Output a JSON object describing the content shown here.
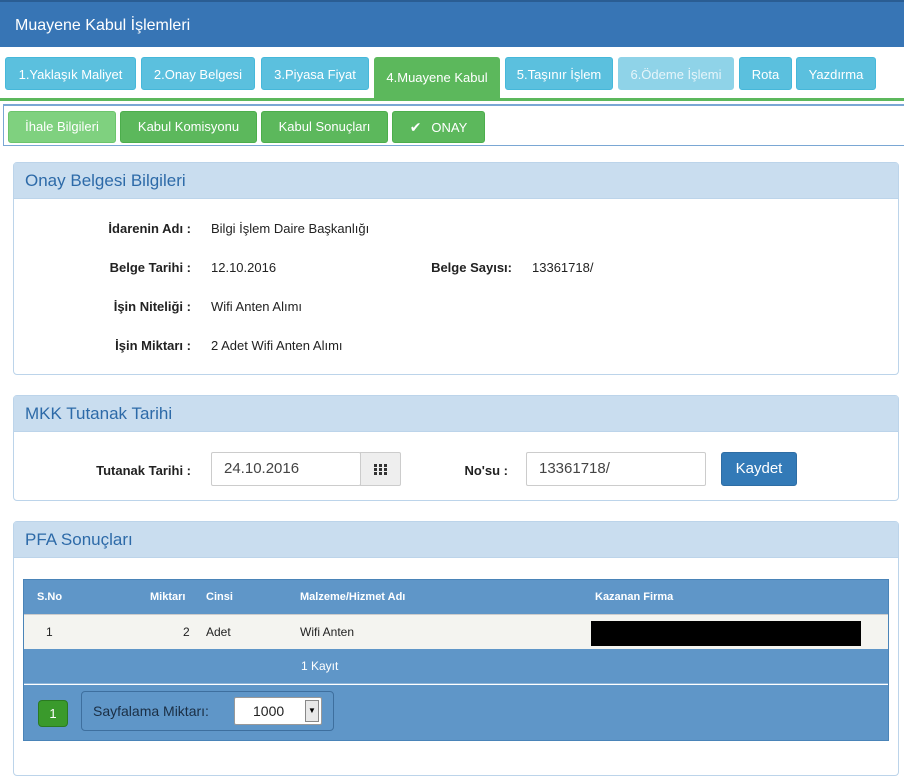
{
  "header": {
    "title": "Muayene Kabul İşlemleri"
  },
  "main_tabs": [
    {
      "label": "1.Yaklaşık Maliyet"
    },
    {
      "label": "2.Onay Belgesi"
    },
    {
      "label": "3.Piyasa Fiyat"
    },
    {
      "label": "4.Muayene Kabul"
    },
    {
      "label": "5.Taşınır İşlem"
    },
    {
      "label": "6.Ödeme İşlemi"
    },
    {
      "label": "Rota"
    },
    {
      "label": "Yazdırma"
    }
  ],
  "sub_tabs": [
    {
      "label": "İhale Bilgileri"
    },
    {
      "label": "Kabul Komisyonu"
    },
    {
      "label": "Kabul Sonuçları"
    },
    {
      "label": "ONAY",
      "icon": "check-icon"
    }
  ],
  "onay_panel": {
    "title": "Onay Belgesi Bilgileri",
    "idare_label": "İdarenin Adı :",
    "idare_value": "Bilgi İşlem Daire Başkanlığı",
    "tarih_label": "Belge Tarihi :",
    "tarih_value": "12.10.2016",
    "sayi_label": "Belge Sayısı:",
    "sayi_value": "13361718/",
    "nitelik_label": "İşin Niteliği :",
    "nitelik_value": "Wifi Anten Alımı",
    "miktar_label": "İşin Miktarı :",
    "miktar_value": "2 Adet Wifi Anten Alımı"
  },
  "mkk_panel": {
    "title": "MKK Tutanak Tarihi",
    "tarih_label": "Tutanak Tarihi :",
    "tarih_value": "24.10.2016",
    "no_label": "No'su :",
    "no_value": "13361718/",
    "save_label": "Kaydet",
    "calendar_icon": "calendar-icon"
  },
  "pfa_panel": {
    "title": "PFA Sonuçları",
    "columns": [
      "S.No",
      "Miktarı",
      "Cinsi",
      "Malzeme/Hizmet Adı",
      "Kazanan Firma"
    ],
    "rows": [
      {
        "sno": "1",
        "miktar": "2",
        "cinsi": "Adet",
        "malzeme": "Wifi Anten",
        "firma": ""
      }
    ],
    "record_count": "1 Kayıt",
    "current_page": "1",
    "page_size_label": "Sayfalama Miktarı:",
    "page_size_value": "1000"
  },
  "colors": {
    "header": "#3775b5",
    "tab": "#5bc0de",
    "active_tab": "#5cb85c",
    "panel_head": "#c9ddef",
    "grid": "#5f96c8"
  }
}
